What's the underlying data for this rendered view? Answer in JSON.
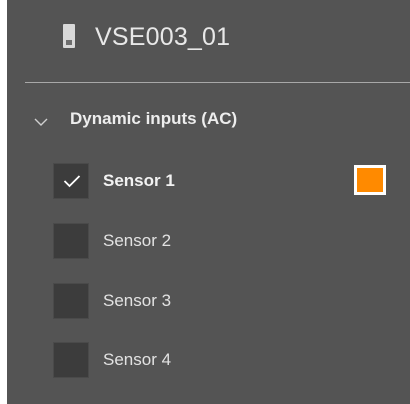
{
  "header": {
    "device_name": "VSE003_01",
    "icon": "device-module-icon"
  },
  "group": {
    "label": "Dynamic inputs (AC)",
    "expanded": true,
    "icon": "chevron-down-icon"
  },
  "sensors": [
    {
      "label": "Sensor 1",
      "checked": true,
      "color": "#ff8a00"
    },
    {
      "label": "Sensor 2",
      "checked": false
    },
    {
      "label": "Sensor 3",
      "checked": false
    },
    {
      "label": "Sensor 4",
      "checked": false
    }
  ],
  "colors": {
    "panel_background": "#545454",
    "checkbox_background": "#3c3c3c",
    "sensor_1_color": "#ff8a00"
  }
}
